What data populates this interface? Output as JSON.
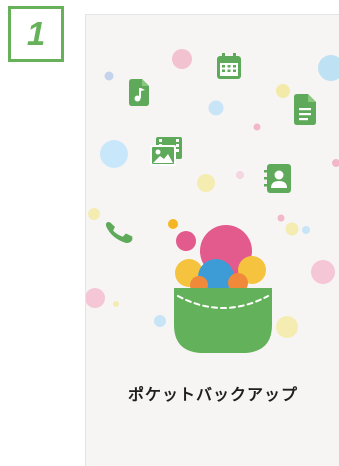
{
  "step": {
    "number": "1"
  },
  "app": {
    "title": "ポケットバックアップ"
  },
  "icons": [
    "music-note-icon",
    "calendar-icon",
    "document-icon",
    "photo-video-icon",
    "contact-book-icon",
    "phone-icon",
    "pocket-bag-logo"
  ],
  "colors": {
    "badge_green": "#68b15b",
    "icon_green": "#5fa95a",
    "pocket_green": "#63b15a",
    "screen_bg": "#f7f5f4",
    "title_text": "#1f1f1f",
    "pink": "#e35a8d",
    "yellow": "#f5c33d",
    "blue": "#3d9bd6",
    "orange": "#f08a3a"
  }
}
